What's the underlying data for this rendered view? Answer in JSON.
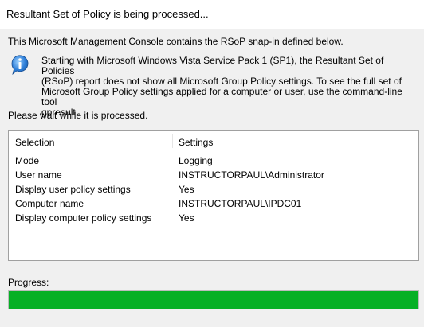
{
  "window": {
    "title": "Resultant Set of Policy is being processed..."
  },
  "intro_text": "This Microsoft Management Console contains the RSoP snap-in defined below.",
  "info": {
    "icon": "info-icon",
    "lines": [
      "Starting with Microsoft Windows Vista Service Pack 1 (SP1), the Resultant Set of Policies",
      "(RSoP) report does not show all Microsoft Group Policy settings.  To see the full set of",
      "Microsoft Group Policy settings applied for a computer or user, use the command-line tool",
      "gpresult."
    ]
  },
  "wait_text": "Please wait while it is processed.",
  "list": {
    "headers": {
      "selection": "Selection",
      "settings": "Settings"
    },
    "rows": [
      {
        "selection": "Mode",
        "settings": "Logging"
      },
      {
        "selection": "User name",
        "settings": "INSTRUCTORPAUL\\Administrator"
      },
      {
        "selection": "Display user policy settings",
        "settings": "Yes"
      },
      {
        "selection": "Computer name",
        "settings": "INSTRUCTORPAUL\\IPDC01"
      },
      {
        "selection": "Display computer policy settings",
        "settings": "Yes"
      }
    ]
  },
  "progress": {
    "label": "Progress:",
    "value": 1.0,
    "color": "#06b025"
  }
}
